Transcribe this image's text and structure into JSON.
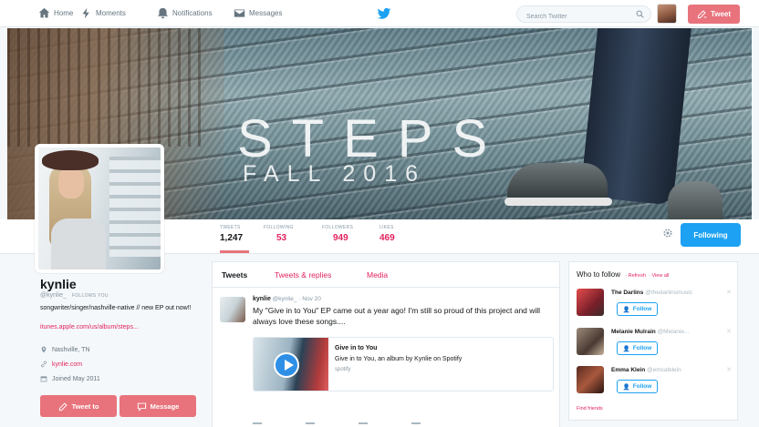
{
  "nav": {
    "home": "Home",
    "moments": "Moments",
    "notifications": "Notifications",
    "messages": "Messages",
    "search_placeholder": "Search Twitter",
    "tweet_button": "Tweet"
  },
  "banner": {
    "title": "STEPS",
    "subtitle": "FALL 2016"
  },
  "stats": [
    {
      "label": "TWEETS",
      "value": "1,247"
    },
    {
      "label": "FOLLOWING",
      "value": "53"
    },
    {
      "label": "FOLLOWERS",
      "value": "949"
    },
    {
      "label": "LIKES",
      "value": "469"
    }
  ],
  "following_button": "Following",
  "profile": {
    "name": "kynlie",
    "handle": "@kynlie_",
    "follows_you": "FOLLOWS YOU",
    "bio": "songwriter/singer/nashville-native // new EP out now!!",
    "link": "itunes.apple.com/us/album/steps...",
    "location": "Nashville, TN",
    "website": "kynlie.com",
    "joined": "Joined May 2011",
    "tweet_to": "Tweet to",
    "message": "Message"
  },
  "timeline": {
    "tabs": [
      "Tweets",
      "Tweets & replies",
      "Media"
    ],
    "tweet": {
      "author": "kynlie",
      "handle": "@kynlie_",
      "date": "· Nov 20",
      "text": "My \"Give in to You\" EP came out a year ago! I'm still so proud of this project and will always love these songs....",
      "card_title": "Give in to You",
      "card_desc": "Give in to You, an album by Kynlie on Spotify",
      "card_source": "spotify"
    }
  },
  "who_to_follow": {
    "title": "Who to follow",
    "refresh": "· Refresh",
    "view_all": "· View all",
    "follow_label": "Follow",
    "find_friends": "Find friends",
    "users": [
      {
        "name": "The Darlins",
        "handle": "@thedarlinsmusic"
      },
      {
        "name": "Melanie Mulrain",
        "handle": "@Melanie..."
      },
      {
        "name": "Emma Klein",
        "handle": "@emcatklein"
      }
    ]
  },
  "colors": {
    "accent": "#e8737c",
    "link": "#e0245e",
    "blue": "#1da1f2"
  }
}
